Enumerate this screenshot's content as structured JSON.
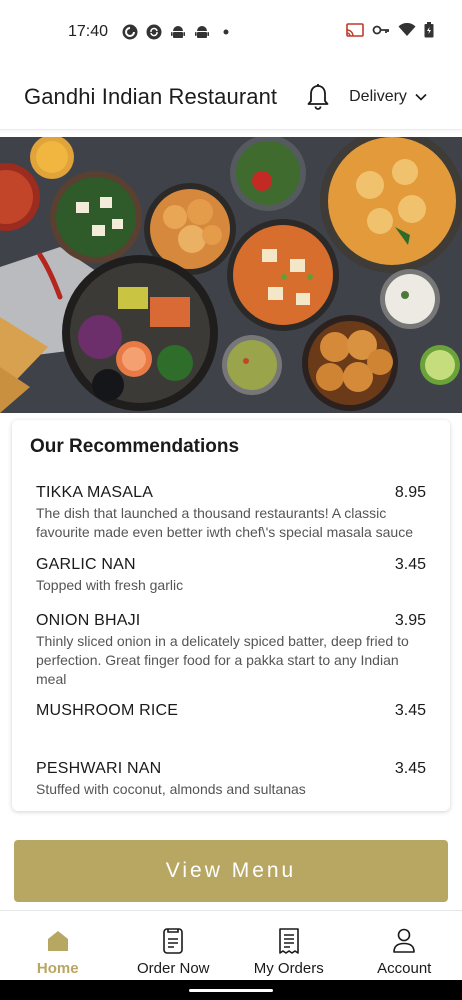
{
  "status_bar": {
    "time": "17:40",
    "left_icons": [
      "pocket-casts-icon",
      "sync-icon",
      "android-icon",
      "android-icon",
      "dot-icon"
    ],
    "right_icons": [
      "cast-icon",
      "vpn-key-icon",
      "wifi-icon",
      "battery-icon"
    ]
  },
  "app_bar": {
    "title": "Gandhi Indian Restaurant",
    "delivery_label": "Delivery"
  },
  "recommendations": {
    "title": "Our Recommendations",
    "items": [
      {
        "name": "TIKKA MASALA",
        "price": "8.95",
        "description": "The dish that launched a thousand restaurants! A classic favourite made even better iwth chef\\'s special masala sauce"
      },
      {
        "name": "GARLIC NAN",
        "price": "3.45",
        "description": "Topped with fresh garlic"
      },
      {
        "name": "ONION BHAJI",
        "price": "3.95",
        "description": "Thinly sliced onion in a delicately spiced batter, deep fried to perfection. Great finger food for a pakka start to any Indian meal"
      },
      {
        "name": "MUSHROOM RICE",
        "price": "3.45",
        "description": ""
      },
      {
        "name": "PESHWARI NAN",
        "price": "3.45",
        "description": "Stuffed with coconut, almonds and sultanas"
      }
    ]
  },
  "view_menu_label": "View Menu",
  "bottom_nav": {
    "items": [
      {
        "label": "Home",
        "icon": "home-icon",
        "active": true
      },
      {
        "label": "Order Now",
        "icon": "order-icon",
        "active": false
      },
      {
        "label": "My Orders",
        "icon": "receipt-icon",
        "active": false
      },
      {
        "label": "Account",
        "icon": "account-icon",
        "active": false
      }
    ]
  },
  "colors": {
    "accent": "#b8a762",
    "text": "#1a1a1a",
    "muted": "#555555"
  }
}
